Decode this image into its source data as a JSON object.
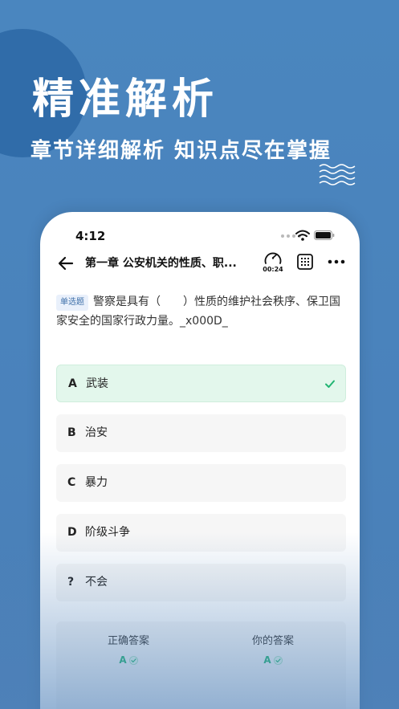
{
  "hero": {
    "title": "精准解析",
    "subtitle": "章节详细解析 知识点尽在掌握"
  },
  "status_bar": {
    "time": "4:12"
  },
  "nav": {
    "title": "第一章 公安机关的性质、职...",
    "timer": "00:24",
    "icons": [
      "back-arrow-icon",
      "timer-icon",
      "answer-sheet-grid-icon",
      "more-icon"
    ]
  },
  "question": {
    "type_tag": "单选题",
    "text": "警察是具有（　　）性质的维护社会秩序、保卫国家安全的国家行政力量。_x000D_"
  },
  "options": [
    {
      "letter": "A",
      "text": "武装",
      "state": "correct"
    },
    {
      "letter": "B",
      "text": "治安",
      "state": "normal"
    },
    {
      "letter": "C",
      "text": "暴力",
      "state": "normal"
    },
    {
      "letter": "D",
      "text": "阶级斗争",
      "state": "normal"
    },
    {
      "letter": "?",
      "text": "不会",
      "state": "normal"
    }
  ],
  "answers": {
    "correct_label": "正确答案",
    "correct_value": "A",
    "yours_label": "你的答案",
    "yours_value": "A"
  },
  "colors": {
    "background": "#4a84bd",
    "accent_circle": "#2d69a6",
    "correct_green": "#22b573",
    "correct_bg": "#e3f7ec",
    "tag_text": "#3d6fa8"
  }
}
